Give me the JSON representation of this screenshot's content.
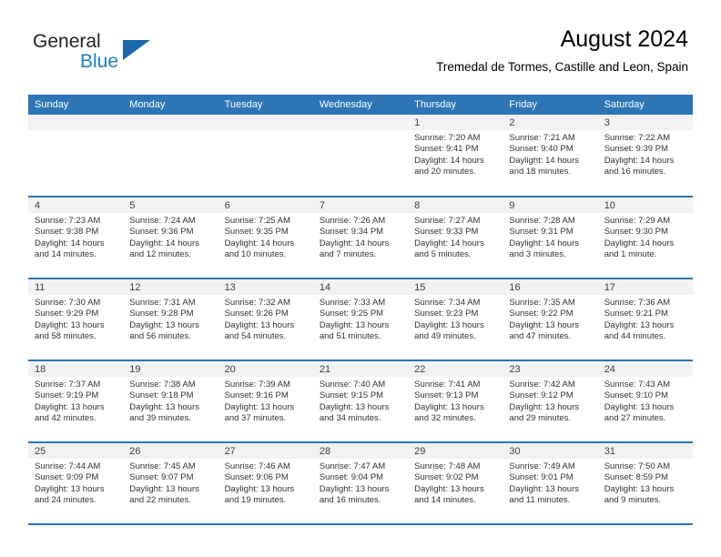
{
  "brand": {
    "name_part1": "General",
    "name_part2": "Blue",
    "triangle_color": "#1b68ad",
    "blue_text_color": "#1d7dc4"
  },
  "header": {
    "title": "August 2024",
    "subtitle": "Tremedal de Tormes, Castille and Leon, Spain",
    "header_bg_color": "#2e75b6",
    "header_text_color": "#ffffff"
  },
  "weekday_headers": [
    "Sunday",
    "Monday",
    "Tuesday",
    "Wednesday",
    "Thursday",
    "Friday",
    "Saturday"
  ],
  "weeks": [
    [
      {
        "day": "",
        "lines": []
      },
      {
        "day": "",
        "lines": []
      },
      {
        "day": "",
        "lines": []
      },
      {
        "day": "",
        "lines": []
      },
      {
        "day": "1",
        "lines": [
          "Sunrise: 7:20 AM",
          "Sunset: 9:41 PM",
          "Daylight: 14 hours",
          "and 20 minutes."
        ]
      },
      {
        "day": "2",
        "lines": [
          "Sunrise: 7:21 AM",
          "Sunset: 9:40 PM",
          "Daylight: 14 hours",
          "and 18 minutes."
        ]
      },
      {
        "day": "3",
        "lines": [
          "Sunrise: 7:22 AM",
          "Sunset: 9:39 PM",
          "Daylight: 14 hours",
          "and 16 minutes."
        ]
      }
    ],
    [
      {
        "day": "4",
        "lines": [
          "Sunrise: 7:23 AM",
          "Sunset: 9:38 PM",
          "Daylight: 14 hours",
          "and 14 minutes."
        ]
      },
      {
        "day": "5",
        "lines": [
          "Sunrise: 7:24 AM",
          "Sunset: 9:36 PM",
          "Daylight: 14 hours",
          "and 12 minutes."
        ]
      },
      {
        "day": "6",
        "lines": [
          "Sunrise: 7:25 AM",
          "Sunset: 9:35 PM",
          "Daylight: 14 hours",
          "and 10 minutes."
        ]
      },
      {
        "day": "7",
        "lines": [
          "Sunrise: 7:26 AM",
          "Sunset: 9:34 PM",
          "Daylight: 14 hours",
          "and 7 minutes."
        ]
      },
      {
        "day": "8",
        "lines": [
          "Sunrise: 7:27 AM",
          "Sunset: 9:33 PM",
          "Daylight: 14 hours",
          "and 5 minutes."
        ]
      },
      {
        "day": "9",
        "lines": [
          "Sunrise: 7:28 AM",
          "Sunset: 9:31 PM",
          "Daylight: 14 hours",
          "and 3 minutes."
        ]
      },
      {
        "day": "10",
        "lines": [
          "Sunrise: 7:29 AM",
          "Sunset: 9:30 PM",
          "Daylight: 14 hours",
          "and 1 minute."
        ]
      }
    ],
    [
      {
        "day": "11",
        "lines": [
          "Sunrise: 7:30 AM",
          "Sunset: 9:29 PM",
          "Daylight: 13 hours",
          "and 58 minutes."
        ]
      },
      {
        "day": "12",
        "lines": [
          "Sunrise: 7:31 AM",
          "Sunset: 9:28 PM",
          "Daylight: 13 hours",
          "and 56 minutes."
        ]
      },
      {
        "day": "13",
        "lines": [
          "Sunrise: 7:32 AM",
          "Sunset: 9:26 PM",
          "Daylight: 13 hours",
          "and 54 minutes."
        ]
      },
      {
        "day": "14",
        "lines": [
          "Sunrise: 7:33 AM",
          "Sunset: 9:25 PM",
          "Daylight: 13 hours",
          "and 51 minutes."
        ]
      },
      {
        "day": "15",
        "lines": [
          "Sunrise: 7:34 AM",
          "Sunset: 9:23 PM",
          "Daylight: 13 hours",
          "and 49 minutes."
        ]
      },
      {
        "day": "16",
        "lines": [
          "Sunrise: 7:35 AM",
          "Sunset: 9:22 PM",
          "Daylight: 13 hours",
          "and 47 minutes."
        ]
      },
      {
        "day": "17",
        "lines": [
          "Sunrise: 7:36 AM",
          "Sunset: 9:21 PM",
          "Daylight: 13 hours",
          "and 44 minutes."
        ]
      }
    ],
    [
      {
        "day": "18",
        "lines": [
          "Sunrise: 7:37 AM",
          "Sunset: 9:19 PM",
          "Daylight: 13 hours",
          "and 42 minutes."
        ]
      },
      {
        "day": "19",
        "lines": [
          "Sunrise: 7:38 AM",
          "Sunset: 9:18 PM",
          "Daylight: 13 hours",
          "and 39 minutes."
        ]
      },
      {
        "day": "20",
        "lines": [
          "Sunrise: 7:39 AM",
          "Sunset: 9:16 PM",
          "Daylight: 13 hours",
          "and 37 minutes."
        ]
      },
      {
        "day": "21",
        "lines": [
          "Sunrise: 7:40 AM",
          "Sunset: 9:15 PM",
          "Daylight: 13 hours",
          "and 34 minutes."
        ]
      },
      {
        "day": "22",
        "lines": [
          "Sunrise: 7:41 AM",
          "Sunset: 9:13 PM",
          "Daylight: 13 hours",
          "and 32 minutes."
        ]
      },
      {
        "day": "23",
        "lines": [
          "Sunrise: 7:42 AM",
          "Sunset: 9:12 PM",
          "Daylight: 13 hours",
          "and 29 minutes."
        ]
      },
      {
        "day": "24",
        "lines": [
          "Sunrise: 7:43 AM",
          "Sunset: 9:10 PM",
          "Daylight: 13 hours",
          "and 27 minutes."
        ]
      }
    ],
    [
      {
        "day": "25",
        "lines": [
          "Sunrise: 7:44 AM",
          "Sunset: 9:09 PM",
          "Daylight: 13 hours",
          "and 24 minutes."
        ]
      },
      {
        "day": "26",
        "lines": [
          "Sunrise: 7:45 AM",
          "Sunset: 9:07 PM",
          "Daylight: 13 hours",
          "and 22 minutes."
        ]
      },
      {
        "day": "27",
        "lines": [
          "Sunrise: 7:46 AM",
          "Sunset: 9:06 PM",
          "Daylight: 13 hours",
          "and 19 minutes."
        ]
      },
      {
        "day": "28",
        "lines": [
          "Sunrise: 7:47 AM",
          "Sunset: 9:04 PM",
          "Daylight: 13 hours",
          "and 16 minutes."
        ]
      },
      {
        "day": "29",
        "lines": [
          "Sunrise: 7:48 AM",
          "Sunset: 9:02 PM",
          "Daylight: 13 hours",
          "and 14 minutes."
        ]
      },
      {
        "day": "30",
        "lines": [
          "Sunrise: 7:49 AM",
          "Sunset: 9:01 PM",
          "Daylight: 13 hours",
          "and 11 minutes."
        ]
      },
      {
        "day": "31",
        "lines": [
          "Sunrise: 7:50 AM",
          "Sunset: 8:59 PM",
          "Daylight: 13 hours",
          "and 9 minutes."
        ]
      }
    ]
  ]
}
